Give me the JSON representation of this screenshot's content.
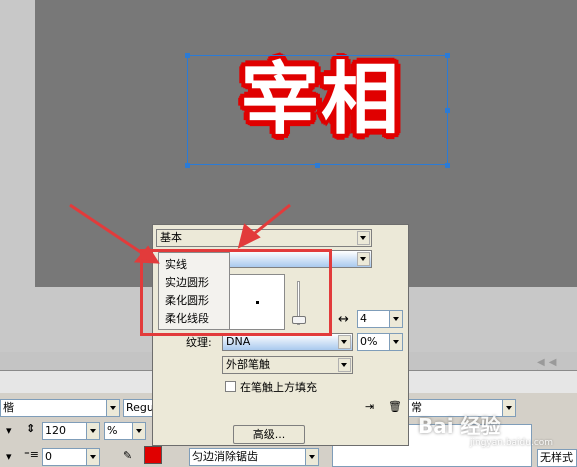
{
  "canvas": {
    "text": "宰相"
  },
  "popup": {
    "category_select": "基本",
    "stroke_type_select": "",
    "stroke_size": "4",
    "texture_label": "纹理:",
    "texture_select": "DNA",
    "texture_percent": "0%",
    "stroke_position_select": "外部笔触",
    "fill_over_checkbox_label": "在笔触上方填充",
    "advanced_button": "高级..."
  },
  "dropdown": {
    "items": [
      "实线",
      "实边圆形",
      "柔化圆形",
      "柔化线段"
    ]
  },
  "props": {
    "font_name": "楷",
    "font_style": "Regul",
    "leading": "120",
    "leading_unit": "%",
    "indent": "0",
    "anti_alias": "匀边消除锯齿",
    "blend_mode": "常",
    "style": "无样式"
  },
  "watermark": {
    "main": "Bai 经验",
    "sub": "jingyan.baidu.com"
  },
  "colors": {
    "canvas": "#787878",
    "text_stroke": "#e00000",
    "selection": "#2b7bd6",
    "highlight": "#e23b3b",
    "swatch": "#e00000"
  }
}
